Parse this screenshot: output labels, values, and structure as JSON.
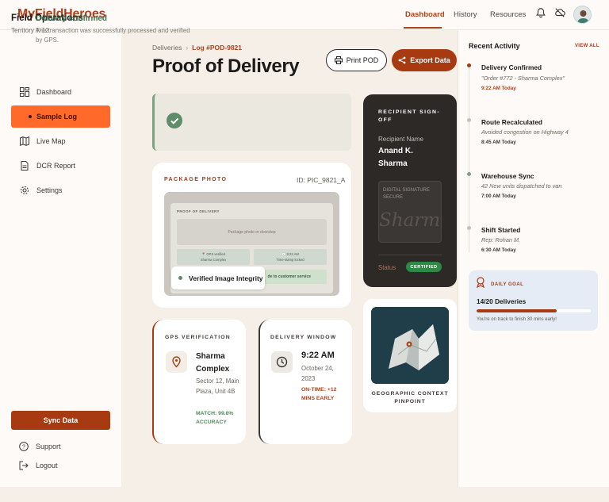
{
  "brand": "MyFieldHeroes",
  "topnav": {
    "items": [
      "Dashboard",
      "History",
      "Resources"
    ],
    "active": 0
  },
  "sidebar": {
    "title": "Field Operations",
    "subtitle": "Territory A-12",
    "items": [
      {
        "label": "Dashboard",
        "icon": "dashboard-icon"
      },
      {
        "label": "Sample Log",
        "icon": "dot-icon",
        "active": true
      },
      {
        "label": "Live Map",
        "icon": "map-icon"
      },
      {
        "label": "DCR Report",
        "icon": "document-icon"
      },
      {
        "label": "Settings",
        "icon": "gear-icon"
      }
    ],
    "sync_label": "Sync Data",
    "support_label": "Support",
    "logout_label": "Logout"
  },
  "breadcrumb": {
    "parent": "Deliveries",
    "current": "Log #POD-9821"
  },
  "page_title": "Proof of Delivery",
  "actions": {
    "print": "Print POD",
    "export": "Export Data"
  },
  "confirmation": {
    "title": "Delivery confirmed",
    "text": "The transaction was successfully processed and verified by GPS."
  },
  "photo": {
    "label": "PACKAGE PHOTO",
    "id": "ID: PIC_9821_A",
    "inner_title": "PROOF OF DELIVERY",
    "inner_drop": "Package photo or doorstep",
    "inner_chip1": "📍 GPS verified",
    "inner_chip1_sub": "Sharma Complex",
    "inner_chip2": "🕘 9:22 AM",
    "inner_chip2_sub": "Time-stamp locked",
    "inner_bar": "de to customer service",
    "verified": "Verified Image Integrity"
  },
  "gps": {
    "label": "GPS VERIFICATION",
    "name": "Sharma Complex",
    "address": "Sector 12, Main Plaza, Unit 4B",
    "match": "MATCH: 99.8% ACCURACY"
  },
  "window": {
    "label": "DELIVERY WINDOW",
    "time": "9:22 AM",
    "date": "October 24, 2023",
    "status": "ON-TIME: +12 MINS EARLY"
  },
  "signoff": {
    "label": "RECIPIENT SIGN-OFF",
    "name_label": "Recipient Name",
    "name": "Anand K. Sharma",
    "sig_caption": "DIGITAL SIGNATURE SECURE",
    "sig_text": "Sharma",
    "status_label": "Status",
    "status_value": "CERTIFIED"
  },
  "map": {
    "caption": "GEOGRAPHIC CONTEXT PINPOINT"
  },
  "activity": {
    "title": "Recent Activity",
    "view_all": "VIEW ALL",
    "items": [
      {
        "title": "Delivery Confirmed",
        "desc": "\"Order #772 - Sharma Complex\"",
        "time": "9:22 AM Today",
        "color": "#a83a12"
      },
      {
        "title": "Route Recalculated",
        "desc": "Avoided congestion on Highway 4",
        "time": "8:45 AM Today",
        "color": "#c9c1b8"
      },
      {
        "title": "Warehouse Sync",
        "desc": "42 New units dispatched to van",
        "time": "7:00 AM Today",
        "color": "#7aa384"
      },
      {
        "title": "Shift Started",
        "desc": "Rep: Rohan M.",
        "time": "6:30 AM Today",
        "color": "#c9c1b8"
      }
    ]
  },
  "goal": {
    "label": "DAILY GOAL",
    "value": "14/20 Deliveries",
    "progress": 0.7,
    "note": "You're on track to finish 30 mins early!"
  },
  "colors": {
    "accent": "#a83a12",
    "active_nav": "#ff6a2b",
    "success": "#2d8a45"
  }
}
